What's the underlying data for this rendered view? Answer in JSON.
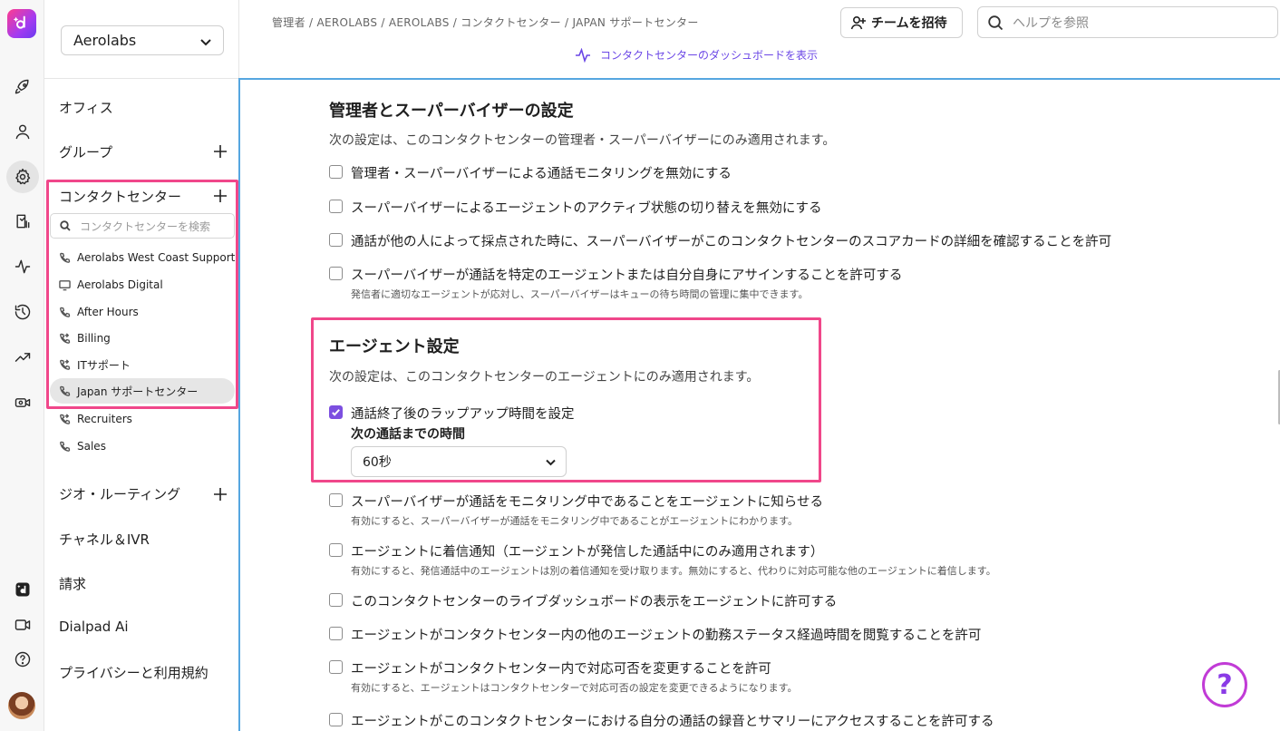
{
  "org_select": {
    "value": "Aerolabs"
  },
  "sidebar": {
    "office": "オフィス",
    "groups": "グループ",
    "contact_centers": "コンタクトセンター",
    "search_placeholder": "コンタクトセンターを検索",
    "cc_items": [
      {
        "label": "Aerolabs West Coast Support",
        "icon": "phone-icon"
      },
      {
        "label": "Aerolabs Digital",
        "icon": "monitor-icon"
      },
      {
        "label": "After Hours",
        "icon": "phone-icon"
      },
      {
        "label": "Billing",
        "icon": "phone-forward-icon"
      },
      {
        "label": "ITサポート",
        "icon": "phone-forward-icon"
      },
      {
        "label": "Japan サポートセンター",
        "icon": "phone-icon"
      },
      {
        "label": "Recruiters",
        "icon": "phone-forward-icon"
      },
      {
        "label": "Sales",
        "icon": "phone-icon"
      }
    ],
    "geo_routing": "ジオ・ルーティング",
    "channels_ivr": "チャネル＆IVR",
    "billing": "請求",
    "dialpad_ai": "Dialpad Ai",
    "privacy": "プライバシーと利用規約"
  },
  "header": {
    "breadcrumb": "管理者 / AEROLABS / AEROLABS / コンタクトセンター / JAPAN サポートセンター",
    "dashboard_link": "コンタクトセンターのダッシュボードを表示",
    "invite_button": "チームを招待",
    "help_placeholder": "ヘルプを参照"
  },
  "admin_section": {
    "title": "管理者とスーパーバイザーの設定",
    "description": "次の設定は、このコンタクトセンターの管理者・スーパーバイザーにのみ適用されます。",
    "options": [
      {
        "label": "管理者・スーパーバイザーによる通話モニタリングを無効にする",
        "checked": false
      },
      {
        "label": "スーパーバイザーによるエージェントのアクティブ状態の切り替えを無効にする",
        "checked": false
      },
      {
        "label": "通話が他の人によって採点された時に、スーパーバイザーがこのコンタクトセンターのスコアカードの詳細を確認することを許可",
        "checked": false
      },
      {
        "label": "スーパーバイザーが通話を特定のエージェントまたは自分自身にアサインすることを許可する",
        "sub": "発信者に適切なエージェントが応対し、スーパーバイザーはキューの待ち時間の管理に集中できます。",
        "checked": false
      }
    ]
  },
  "agent_section": {
    "title": "エージェント設定",
    "description": "次の設定は、このコンタクトセンターのエージェントにのみ適用されます。",
    "wrapup": {
      "label": "通話終了後のラップアップ時間を設定",
      "checked": true,
      "time_label": "次の通話までの時間",
      "time_value": "60秒"
    },
    "options": [
      {
        "label": "スーパーバイザーが通話をモニタリング中であることをエージェントに知らせる",
        "sub": "有効にすると、スーパーバイザーが通話をモニタリング中であることがエージェントにわかります。",
        "checked": false
      },
      {
        "label": "エージェントに着信通知（エージェントが発信した通話中にのみ適用されます）",
        "sub": "有効にすると、発信通話中のエージェントは別の着信通知を受け取ります。無効にすると、代わりに対応可能な他のエージェントに着信します。",
        "checked": false
      },
      {
        "label": "このコンタクトセンターのライブダッシュボードの表示をエージェントに許可する",
        "checked": false
      },
      {
        "label": "エージェントがコンタクトセンター内の他のエージェントの勤務ステータス経過時間を閲覧することを許可",
        "checked": false
      },
      {
        "label": "エージェントがコンタクトセンター内で対応可否を変更することを許可",
        "sub": "有効にすると、エージェントはコンタクトセンターで対応可否の設定を変更できるようになります。",
        "checked": false
      },
      {
        "label": "エージェントがこのコンタクトセンターにおける自分の通話の録音とサマリーにアクセスすることを許可する",
        "checked": false
      }
    ]
  },
  "help_fab": "?"
}
